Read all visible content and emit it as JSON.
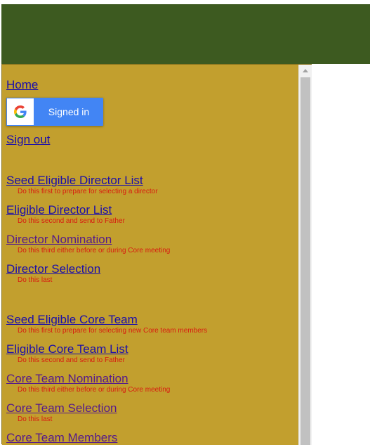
{
  "links": {
    "home": "Home",
    "sign_out": "Sign out",
    "seed_director": "Seed Eligible Director List",
    "eligible_director": "Eligible Director List",
    "director_nomination": "Director Nomination",
    "director_selection": "Director Selection",
    "seed_core": "Seed Eligible Core Team",
    "eligible_core": "Eligible Core Team List",
    "core_nomination": "Core Team Nomination",
    "core_selection": "Core Team Selection",
    "core_members": "Core Team Members"
  },
  "hints": {
    "seed_director": "Do this first to prepare for selecting a director",
    "eligible_director": "Do this second and send to Father",
    "director_nomination": "Do this third either before or during Core meeting",
    "director_selection": "Do this last",
    "seed_core": "Do this first to prepare for selecting new Core team members",
    "eligible_core": "Do this second and send to Father",
    "core_nomination": "Do this third either before or during Core meeting",
    "core_selection": "Do this last"
  },
  "google_button": {
    "label": "Signed in",
    "icon": "google-g-icon"
  },
  "colors": {
    "header": "#3d5a20",
    "panel": "#c29f2e",
    "link": "#1a0dab",
    "visited_link": "#551a8b",
    "hint": "#d81b10",
    "google_blue": "#4285f4"
  }
}
